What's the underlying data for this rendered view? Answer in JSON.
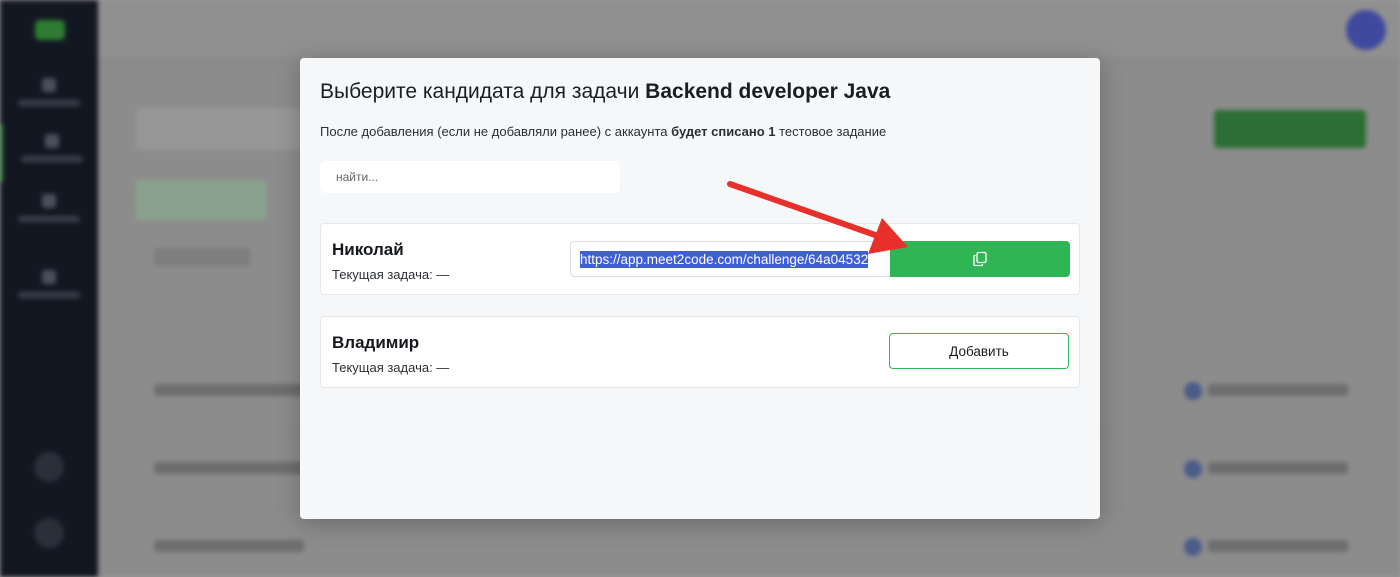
{
  "modal": {
    "title_prefix": "Выберите кандидата для задачи",
    "title_task": "Backend developer Java",
    "subtitle_before": "После добавления (если не добавляли ранее) с аккаунта",
    "subtitle_bold": "будет списано 1",
    "subtitle_after": "тестовое задание",
    "search_placeholder": "найти..."
  },
  "candidates": [
    {
      "name": "Николай",
      "task_label": "Текущая задача: —",
      "link": "https://app.meet2code.com/challenge/64a04532",
      "copy_icon": "copy-icon"
    },
    {
      "name": "Владимир",
      "task_label": "Текущая задача: —",
      "add_label": "Добавить"
    }
  ],
  "colors": {
    "accent_green": "#2fb553",
    "selection_blue": "#3f5fd6",
    "annotation_red": "#e8302a",
    "sidebar": "#131722"
  }
}
